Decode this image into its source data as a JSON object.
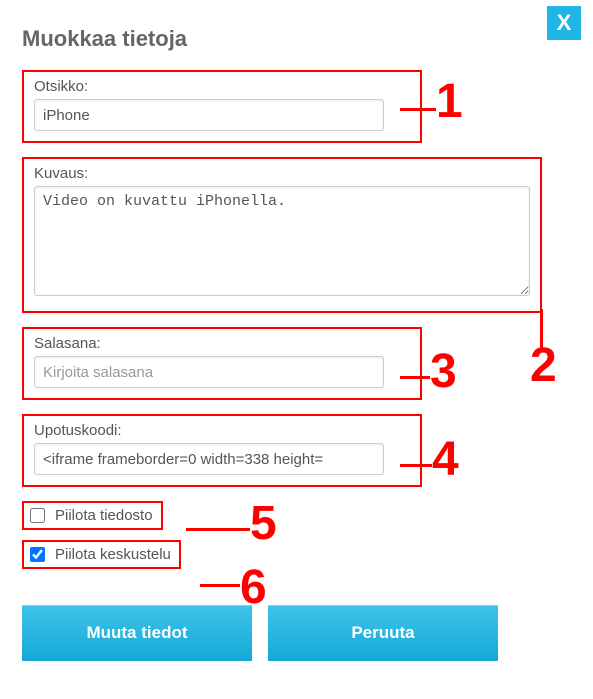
{
  "close_label": "X",
  "title": "Muokkaa tietoja",
  "fields": {
    "otsikko": {
      "label": "Otsikko:",
      "value": "iPhone"
    },
    "kuvaus": {
      "label": "Kuvaus:",
      "value": "Video on kuvattu iPhonella."
    },
    "salasana": {
      "label": "Salasana:",
      "placeholder": "Kirjoita salasana"
    },
    "upotus": {
      "label": "Upotuskoodi:",
      "value": "<iframe frameborder=0 width=338 height="
    }
  },
  "checkboxes": {
    "piilota_tiedosto": {
      "label": "Piilota tiedosto",
      "checked": false
    },
    "piilota_keskustelu": {
      "label": "Piilota keskustelu",
      "checked": true
    }
  },
  "buttons": {
    "submit": "Muuta tiedot",
    "cancel": "Peruuta"
  },
  "annotations": {
    "a1": "1",
    "a2": "2",
    "a3": "3",
    "a4": "4",
    "a5": "5",
    "a6": "6"
  }
}
